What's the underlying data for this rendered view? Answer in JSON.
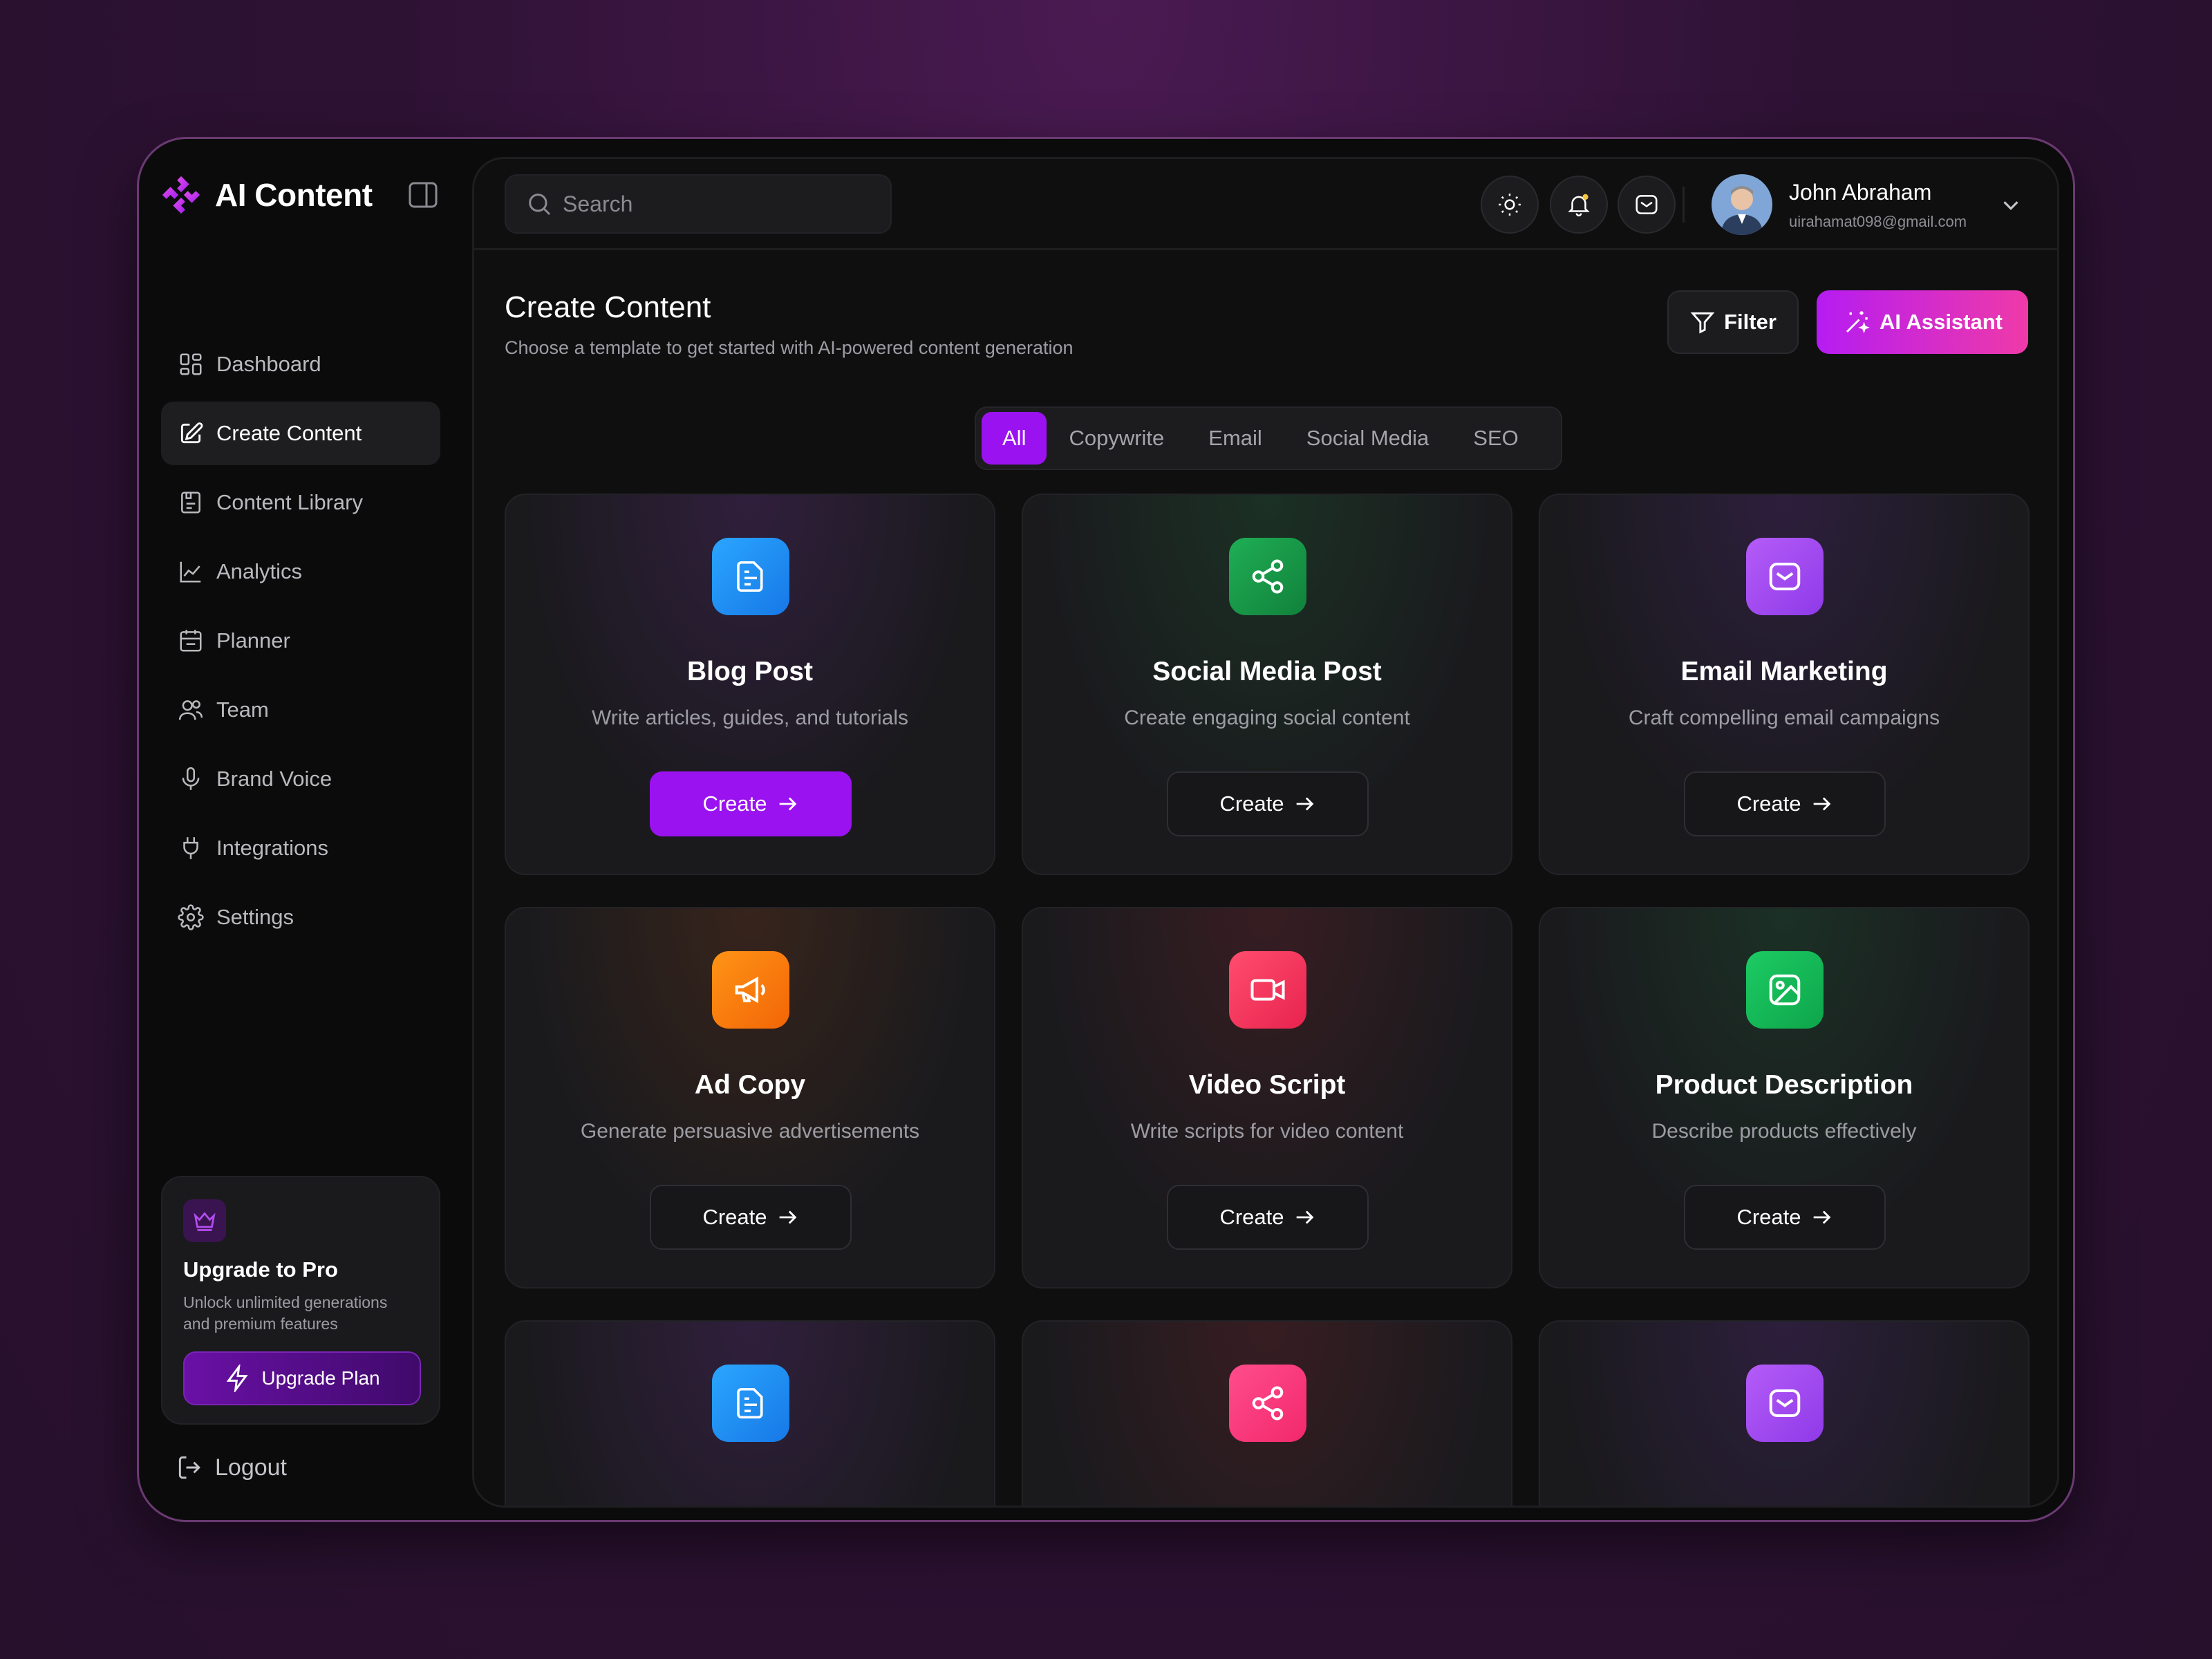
{
  "brand": {
    "name": "AI Content"
  },
  "sidebar": {
    "items": [
      {
        "label": "Dashboard",
        "icon": "dashboard-icon",
        "active": false
      },
      {
        "label": "Create Content",
        "icon": "edit-icon",
        "active": true
      },
      {
        "label": "Content Library",
        "icon": "library-icon",
        "active": false
      },
      {
        "label": "Analytics",
        "icon": "analytics-icon",
        "active": false
      },
      {
        "label": "Planner",
        "icon": "calendar-icon",
        "active": false
      },
      {
        "label": "Team",
        "icon": "team-icon",
        "active": false
      },
      {
        "label": "Brand Voice",
        "icon": "microphone-icon",
        "active": false
      },
      {
        "label": "Integrations",
        "icon": "plug-icon",
        "active": false
      },
      {
        "label": "Settings",
        "icon": "gear-icon",
        "active": false
      }
    ],
    "upgrade": {
      "title": "Upgrade to Pro",
      "desc_line1": "Unlock unlimited generations",
      "desc_line2": "and premium features",
      "button": "Upgrade Plan"
    },
    "logout": "Logout"
  },
  "topbar": {
    "search_placeholder": "Search",
    "user": {
      "name": "John Abraham",
      "email": "uirahamat098@gmail.com"
    }
  },
  "page": {
    "title": "Create Content",
    "subtitle": "Choose a template to get started with AI-powered content generation",
    "filter_label": "Filter",
    "ai_label": "AI Assistant"
  },
  "tabs": [
    {
      "label": "All",
      "active": true
    },
    {
      "label": "Copywrite",
      "active": false
    },
    {
      "label": "Email",
      "active": false
    },
    {
      "label": "Social Media",
      "active": false
    },
    {
      "label": "SEO",
      "active": false
    }
  ],
  "cards": [
    {
      "title": "Blog Post",
      "desc": "Write articles, guides, and tutorials",
      "button": "Create",
      "icon": "document-icon",
      "primary": true
    },
    {
      "title": "Social Media Post",
      "desc": "Create engaging social content",
      "button": "Create",
      "icon": "share-icon",
      "primary": false
    },
    {
      "title": "Email Marketing",
      "desc": "Craft compelling email campaigns",
      "button": "Create",
      "icon": "mail-icon",
      "primary": false
    },
    {
      "title": "Ad Copy",
      "desc": "Generate persuasive advertisements",
      "button": "Create",
      "icon": "megaphone-icon",
      "primary": false
    },
    {
      "title": "Video Script",
      "desc": "Write scripts for video content",
      "button": "Create",
      "icon": "video-icon",
      "primary": false
    },
    {
      "title": "Product Description",
      "desc": "Describe products effectively",
      "button": "Create",
      "icon": "image-icon",
      "primary": false
    }
  ],
  "colors": {
    "accent": "#9b12f0",
    "ai_gradient_start": "#b51cf2",
    "ai_gradient_end": "#ef3aa8",
    "icon_blue": "#1f8ff0",
    "icon_green": "#16a34a",
    "icon_purple": "#a34df5",
    "icon_orange": "#fb7a0a",
    "icon_red": "#f43f5e",
    "icon_emerald": "#12b857",
    "icon_pink": "#f7357a"
  }
}
